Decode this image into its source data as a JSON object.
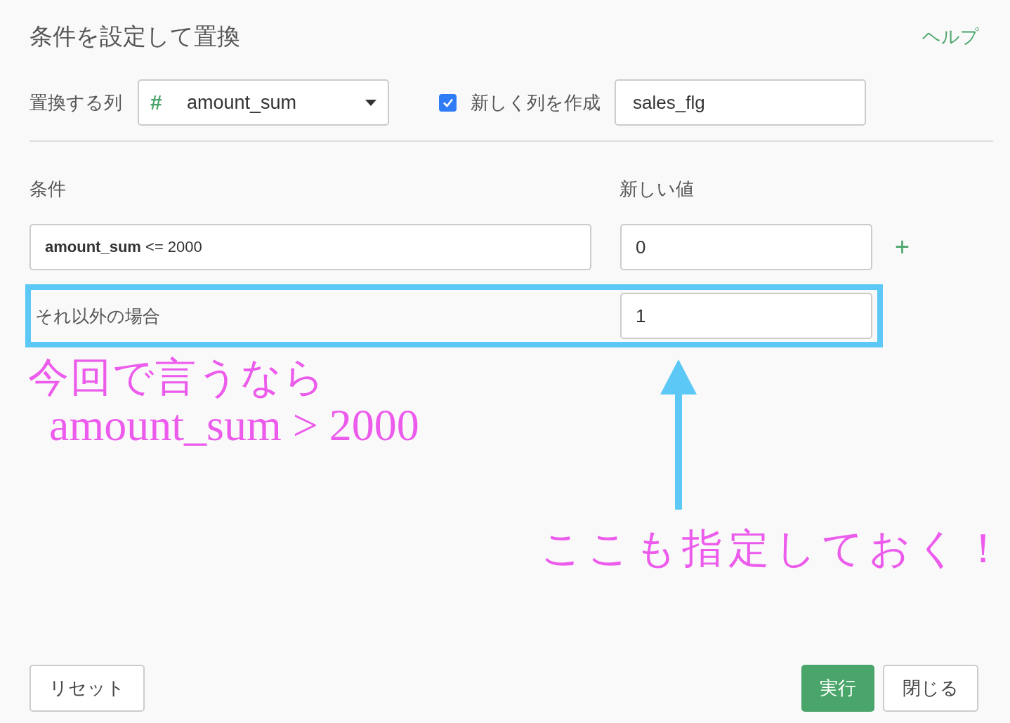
{
  "dialog": {
    "title": "条件を設定して置換",
    "help_link": "ヘルプ"
  },
  "target": {
    "label": "置換する列",
    "column_type_icon": "#",
    "column": "amount_sum",
    "new_column": {
      "checked": true,
      "label": "新しく列を作成",
      "value": "sales_flg"
    }
  },
  "conditions": {
    "condition_header": "条件",
    "value_header": "新しい値",
    "rows": [
      {
        "condition": "**amount_sum** <= 2000",
        "value": "0",
        "add_button": "+"
      }
    ],
    "else": {
      "label": "それ以外の場合",
      "value": "1",
      "highlighted": true
    }
  },
  "annotations": [
    {
      "text": "今回で言うなら"
    },
    {
      "text": "amount_sum > 2000"
    },
    {
      "text": "ここも指定しておく！"
    }
  ],
  "buttons": {
    "reset": "リセット",
    "run": "実行",
    "close": "閉じる"
  }
}
